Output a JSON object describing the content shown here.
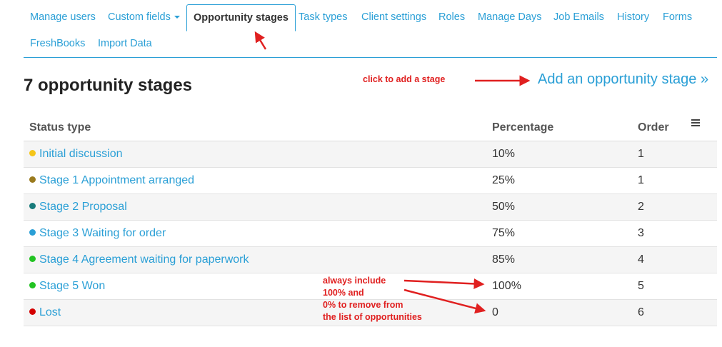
{
  "nav": {
    "tabs": [
      {
        "label": "Manage users"
      },
      {
        "label": "Custom fields"
      },
      {
        "label": "Opportunity stages"
      },
      {
        "label": "Task types"
      },
      {
        "label": "Client settings"
      },
      {
        "label": "Roles"
      },
      {
        "label": "Manage Days"
      },
      {
        "label": "Job Emails"
      },
      {
        "label": "History"
      },
      {
        "label": "Forms"
      },
      {
        "label": "FreshBooks"
      },
      {
        "label": "Import Data"
      }
    ],
    "active_tab": "Opportunity stages"
  },
  "page": {
    "title": "7 opportunity stages",
    "add_link": "Add an opportunity stage »"
  },
  "table": {
    "headers": {
      "status": "Status type",
      "percentage": "Percentage",
      "order": "Order"
    },
    "rows": [
      {
        "name": "Initial discussion",
        "percentage": "10%",
        "order": "1",
        "color": "#f5c518"
      },
      {
        "name": "Stage 1 Appointment arranged",
        "percentage": "25%",
        "order": "1",
        "color": "#9a7a1e"
      },
      {
        "name": "Stage 2 Proposal",
        "percentage": "50%",
        "order": "2",
        "color": "#177a7a"
      },
      {
        "name": "Stage 3 Waiting for order",
        "percentage": "75%",
        "order": "3",
        "color": "#2a9fd6"
      },
      {
        "name": "Stage 4 Agreement waiting for paperwork",
        "percentage": "85%",
        "order": "4",
        "color": "#22c322"
      },
      {
        "name": "Stage 5 Won",
        "percentage": "100%",
        "order": "5",
        "color": "#22c322"
      },
      {
        "name": "Lost",
        "percentage": "0",
        "order": "6",
        "color": "#d40000"
      }
    ]
  },
  "annotations": {
    "add_stage": "click to add a stage",
    "include_1": "always include",
    "include_2": "100% and",
    "include_3": "0% to remove from",
    "include_4": "the list of opportunities"
  },
  "colors": {
    "accent": "#2a9fd6",
    "annotation": "#e02020"
  }
}
